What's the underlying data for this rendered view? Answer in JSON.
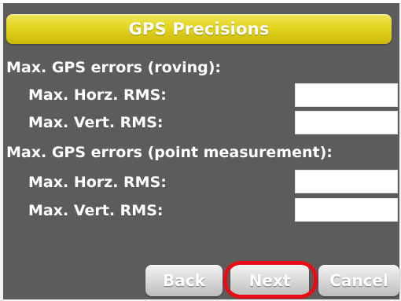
{
  "dialog": {
    "title": "GPS Precisions"
  },
  "roving": {
    "section_label": "Max. GPS errors (roving):",
    "horz_label": "Max. Horz. RMS:",
    "horz_value": "",
    "vert_label": "Max. Vert. RMS:",
    "vert_value": ""
  },
  "point_measurement": {
    "section_label": "Max. GPS errors (point measurement):",
    "horz_label": "Max. Horz. RMS:",
    "horz_value": "",
    "vert_label": "Max. Vert. RMS:",
    "vert_value": ""
  },
  "buttons": {
    "back_label": "Back",
    "next_label": "Next",
    "cancel_label": "Cancel"
  },
  "colors": {
    "title_bar": "#e4d51e",
    "panel_background": "#5c5c5c",
    "highlight_ring": "#e60d14"
  }
}
